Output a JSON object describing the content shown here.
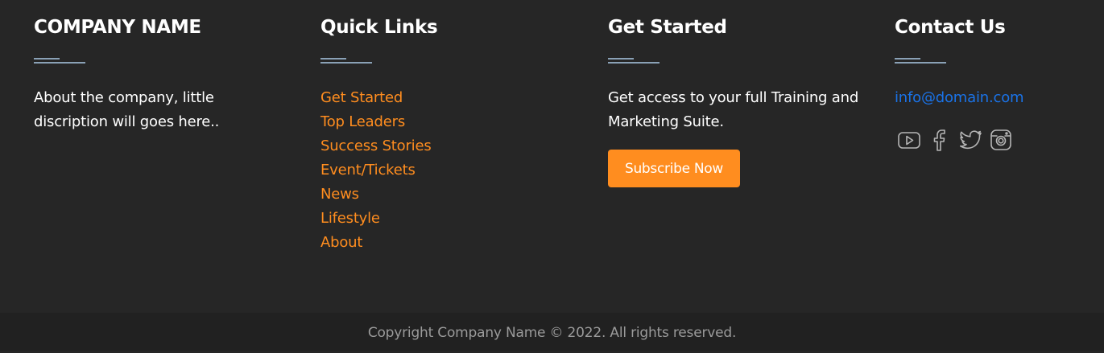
{
  "company": {
    "title": "COMPANY NAME",
    "about": "About the company, little discription will goes here.."
  },
  "quick_links": {
    "title": "Quick Links",
    "items": [
      {
        "label": "Get Started"
      },
      {
        "label": "Top Leaders"
      },
      {
        "label": "Success Stories"
      },
      {
        "label": "Event/Tickets"
      },
      {
        "label": "News"
      },
      {
        "label": "Lifestyle"
      },
      {
        "label": "About"
      }
    ]
  },
  "get_started": {
    "title": "Get Started",
    "description": "Get access to your full Training and Marketing Suite.",
    "button_label": "Subscribe Now"
  },
  "contact": {
    "title": "Contact Us",
    "email": "info@domain.com",
    "social_icons": [
      "youtube-icon",
      "facebook-icon",
      "twitter-icon",
      "instagram-icon"
    ]
  },
  "footer": {
    "copyright": "Copyright Company Name © 2022. All rights reserved."
  },
  "colors": {
    "background": "#262626",
    "bottom_bar": "#212121",
    "accent": "#ff8d1f",
    "link_blue": "#1a73e8",
    "divider": "#8aa1b6",
    "icon_gray": "#b5b5b5",
    "copyright_gray": "#9a9a9a"
  }
}
